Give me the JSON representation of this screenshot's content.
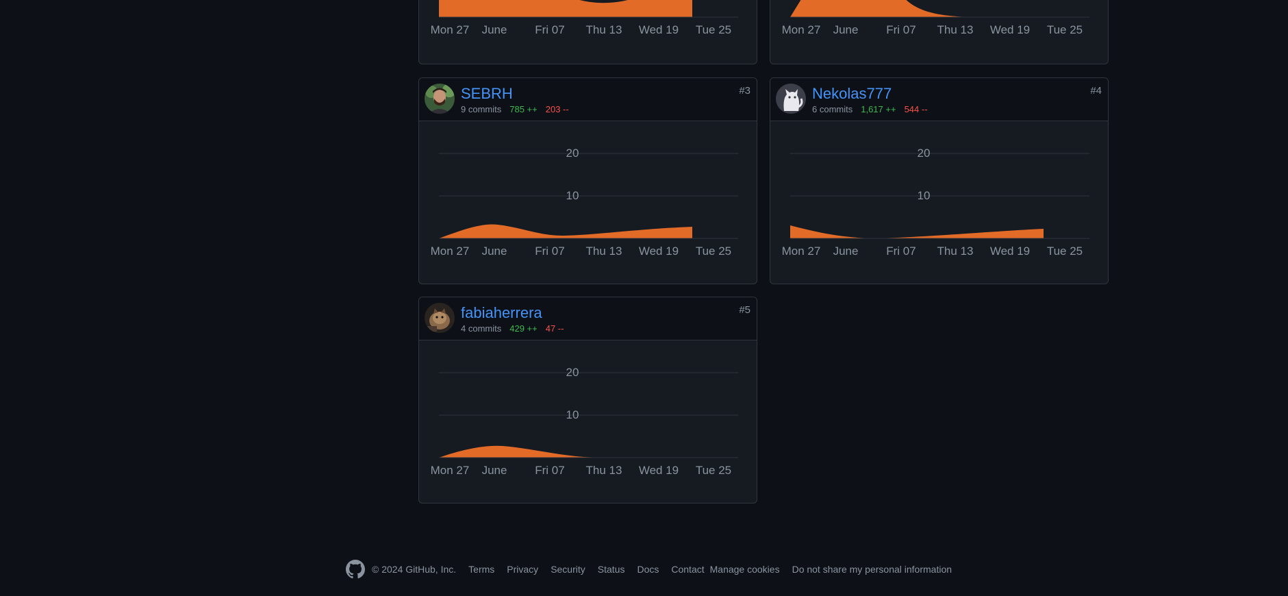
{
  "axis": {
    "x_ticks": [
      "Mon 27",
      "June",
      "Fri 07",
      "Thu 13",
      "Wed 19",
      "Tue 25"
    ],
    "y_ticks": [
      "20",
      "10"
    ]
  },
  "colors": {
    "area": "#e36b28",
    "link": "#4493f8",
    "additions": "#3fb950",
    "deletions": "#f85149"
  },
  "contributors": [
    {
      "rank": "#3",
      "name": "SEBRH",
      "commits": "9 commits",
      "additions": "785 ++",
      "deletions": "203 --",
      "avatar_icon": "photo-avatar"
    },
    {
      "rank": "#4",
      "name": "Nekolas777",
      "commits": "6 commits",
      "additions": "1,617 ++",
      "deletions": "544 --",
      "avatar_icon": "cat-avatar"
    },
    {
      "rank": "#5",
      "name": "fabiaherrera",
      "commits": "4 commits",
      "additions": "429 ++",
      "deletions": "47 --",
      "avatar_icon": "cat-photo-avatar"
    }
  ],
  "footer": {
    "copyright": "© 2024 GitHub, Inc.",
    "links": [
      "Terms",
      "Privacy",
      "Security",
      "Status",
      "Docs",
      "Contact",
      "Manage cookies",
      "Do not share my personal information"
    ]
  }
}
